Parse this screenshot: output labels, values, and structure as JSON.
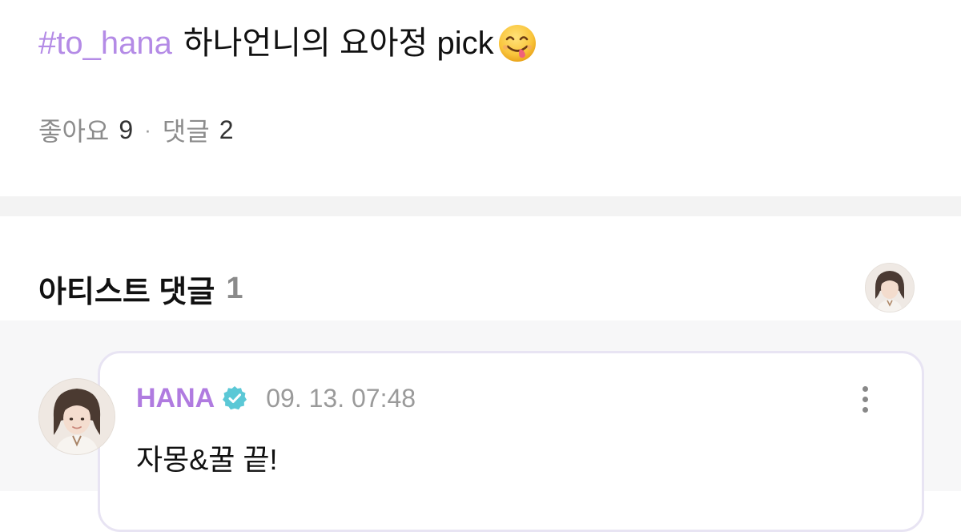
{
  "post": {
    "hashtag": "#to_hana",
    "text": "하나언니의 요아정 pick",
    "emoji": "face-savoring-food-icon",
    "likes_label": "좋아요",
    "likes_count": "9",
    "separator": "·",
    "comments_label": "댓글",
    "comments_count": "2"
  },
  "artist_comments": {
    "title": "아티스트 댓글",
    "count": "1",
    "comments": [
      {
        "author": "HANA",
        "verified": true,
        "timestamp": "09. 13. 07:48",
        "text": "자몽&꿀 끝!"
      }
    ]
  },
  "colors": {
    "hashtag": "#b48be6",
    "author": "#b07be0",
    "verified_badge": "#5bc8d6",
    "divider": "#f3f3f3",
    "card_border": "#e8e4f3"
  },
  "icons": {
    "emoji": "face-savoring-food-icon",
    "verified": "verified-badge-icon",
    "more": "more-vertical-icon"
  }
}
